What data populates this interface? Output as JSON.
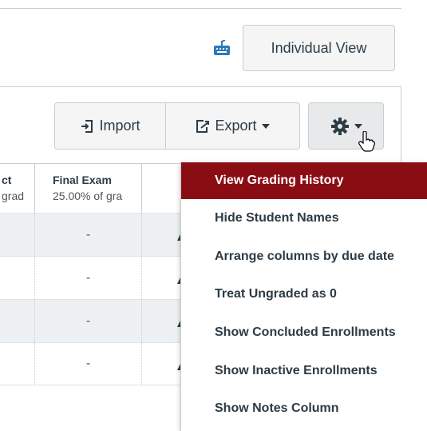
{
  "header": {
    "individual_view_label": "Individual View"
  },
  "toolbar": {
    "import_label": "Import",
    "export_label": "Export"
  },
  "grid": {
    "columns": [
      {
        "name": "ct",
        "sub": "grad"
      },
      {
        "name": "Final Exam",
        "sub": "25.00% of gra"
      }
    ],
    "rows": [
      {
        "final_exam": "-"
      },
      {
        "final_exam": "-"
      },
      {
        "final_exam": "-"
      },
      {
        "final_exam": "-"
      }
    ]
  },
  "settings_menu": {
    "items": [
      {
        "label": "View Grading History",
        "active": true
      },
      {
        "label": "Hide Student Names"
      },
      {
        "label": "Arrange columns by due date"
      },
      {
        "label": "Treat Ungraded as 0"
      },
      {
        "label": "Show Concluded Enrollments"
      },
      {
        "label": "Show Inactive Enrollments"
      },
      {
        "label": "Show Notes Column"
      }
    ]
  },
  "colors": {
    "menu_active_bg": "#8b0d14",
    "keyboard_icon": "#2b7abc"
  },
  "icons": [
    "keyboard-icon",
    "import-icon",
    "export-icon",
    "caret-down-icon",
    "gear-icon",
    "hand-cursor-icon"
  ]
}
